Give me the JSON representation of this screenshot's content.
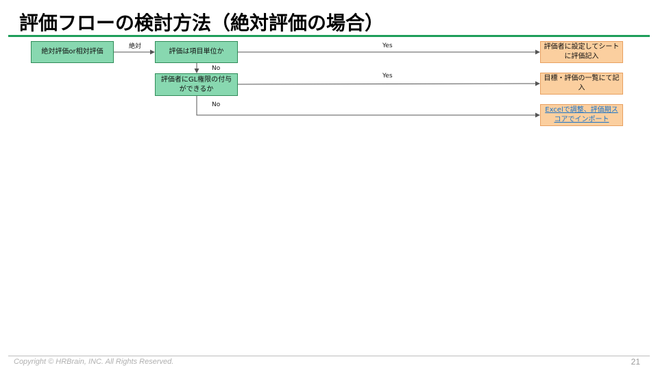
{
  "title": "評価フローの検討方法（絶対評価の場合）",
  "nodes": {
    "start": "絶対評価or相対評価",
    "q1": "評価は項目単位か",
    "q2": "評価者にGL権限の付与ができるか",
    "r1": "評価者に設定してシートに評価記入",
    "r2": "目標・評価の一覧にて記入",
    "r3": "Excelで調整、評価期スコアでインポート"
  },
  "edge_labels": {
    "start_q1": "絶対",
    "q1_r1": "Yes",
    "q1_q2": "No",
    "q2_r2": "Yes",
    "q2_r3": "No"
  },
  "footer": {
    "copyright": "Copyright © HRBrain, INC.  All Rights Reserved.",
    "page_number": "21"
  },
  "colors": {
    "accent_rule": "#1e9e5a",
    "decision_fill": "#88d8b0",
    "result_fill": "#fbcf9f",
    "link": "#1a73c8"
  }
}
